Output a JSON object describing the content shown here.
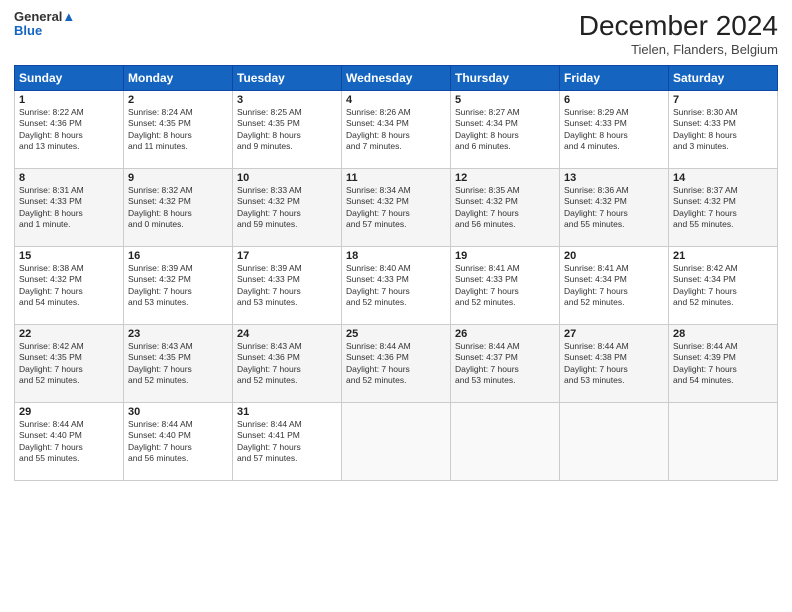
{
  "header": {
    "logo_line1": "General",
    "logo_line2": "Blue",
    "month": "December 2024",
    "location": "Tielen, Flanders, Belgium"
  },
  "weekdays": [
    "Sunday",
    "Monday",
    "Tuesday",
    "Wednesday",
    "Thursday",
    "Friday",
    "Saturday"
  ],
  "weeks": [
    [
      {
        "day": "1",
        "info": "Sunrise: 8:22 AM\nSunset: 4:36 PM\nDaylight: 8 hours\nand 13 minutes."
      },
      {
        "day": "2",
        "info": "Sunrise: 8:24 AM\nSunset: 4:35 PM\nDaylight: 8 hours\nand 11 minutes."
      },
      {
        "day": "3",
        "info": "Sunrise: 8:25 AM\nSunset: 4:35 PM\nDaylight: 8 hours\nand 9 minutes."
      },
      {
        "day": "4",
        "info": "Sunrise: 8:26 AM\nSunset: 4:34 PM\nDaylight: 8 hours\nand 7 minutes."
      },
      {
        "day": "5",
        "info": "Sunrise: 8:27 AM\nSunset: 4:34 PM\nDaylight: 8 hours\nand 6 minutes."
      },
      {
        "day": "6",
        "info": "Sunrise: 8:29 AM\nSunset: 4:33 PM\nDaylight: 8 hours\nand 4 minutes."
      },
      {
        "day": "7",
        "info": "Sunrise: 8:30 AM\nSunset: 4:33 PM\nDaylight: 8 hours\nand 3 minutes."
      }
    ],
    [
      {
        "day": "8",
        "info": "Sunrise: 8:31 AM\nSunset: 4:33 PM\nDaylight: 8 hours\nand 1 minute."
      },
      {
        "day": "9",
        "info": "Sunrise: 8:32 AM\nSunset: 4:32 PM\nDaylight: 8 hours\nand 0 minutes."
      },
      {
        "day": "10",
        "info": "Sunrise: 8:33 AM\nSunset: 4:32 PM\nDaylight: 7 hours\nand 59 minutes."
      },
      {
        "day": "11",
        "info": "Sunrise: 8:34 AM\nSunset: 4:32 PM\nDaylight: 7 hours\nand 57 minutes."
      },
      {
        "day": "12",
        "info": "Sunrise: 8:35 AM\nSunset: 4:32 PM\nDaylight: 7 hours\nand 56 minutes."
      },
      {
        "day": "13",
        "info": "Sunrise: 8:36 AM\nSunset: 4:32 PM\nDaylight: 7 hours\nand 55 minutes."
      },
      {
        "day": "14",
        "info": "Sunrise: 8:37 AM\nSunset: 4:32 PM\nDaylight: 7 hours\nand 55 minutes."
      }
    ],
    [
      {
        "day": "15",
        "info": "Sunrise: 8:38 AM\nSunset: 4:32 PM\nDaylight: 7 hours\nand 54 minutes."
      },
      {
        "day": "16",
        "info": "Sunrise: 8:39 AM\nSunset: 4:32 PM\nDaylight: 7 hours\nand 53 minutes."
      },
      {
        "day": "17",
        "info": "Sunrise: 8:39 AM\nSunset: 4:33 PM\nDaylight: 7 hours\nand 53 minutes."
      },
      {
        "day": "18",
        "info": "Sunrise: 8:40 AM\nSunset: 4:33 PM\nDaylight: 7 hours\nand 52 minutes."
      },
      {
        "day": "19",
        "info": "Sunrise: 8:41 AM\nSunset: 4:33 PM\nDaylight: 7 hours\nand 52 minutes."
      },
      {
        "day": "20",
        "info": "Sunrise: 8:41 AM\nSunset: 4:34 PM\nDaylight: 7 hours\nand 52 minutes."
      },
      {
        "day": "21",
        "info": "Sunrise: 8:42 AM\nSunset: 4:34 PM\nDaylight: 7 hours\nand 52 minutes."
      }
    ],
    [
      {
        "day": "22",
        "info": "Sunrise: 8:42 AM\nSunset: 4:35 PM\nDaylight: 7 hours\nand 52 minutes."
      },
      {
        "day": "23",
        "info": "Sunrise: 8:43 AM\nSunset: 4:35 PM\nDaylight: 7 hours\nand 52 minutes."
      },
      {
        "day": "24",
        "info": "Sunrise: 8:43 AM\nSunset: 4:36 PM\nDaylight: 7 hours\nand 52 minutes."
      },
      {
        "day": "25",
        "info": "Sunrise: 8:44 AM\nSunset: 4:36 PM\nDaylight: 7 hours\nand 52 minutes."
      },
      {
        "day": "26",
        "info": "Sunrise: 8:44 AM\nSunset: 4:37 PM\nDaylight: 7 hours\nand 53 minutes."
      },
      {
        "day": "27",
        "info": "Sunrise: 8:44 AM\nSunset: 4:38 PM\nDaylight: 7 hours\nand 53 minutes."
      },
      {
        "day": "28",
        "info": "Sunrise: 8:44 AM\nSunset: 4:39 PM\nDaylight: 7 hours\nand 54 minutes."
      }
    ],
    [
      {
        "day": "29",
        "info": "Sunrise: 8:44 AM\nSunset: 4:40 PM\nDaylight: 7 hours\nand 55 minutes."
      },
      {
        "day": "30",
        "info": "Sunrise: 8:44 AM\nSunset: 4:40 PM\nDaylight: 7 hours\nand 56 minutes."
      },
      {
        "day": "31",
        "info": "Sunrise: 8:44 AM\nSunset: 4:41 PM\nDaylight: 7 hours\nand 57 minutes."
      },
      {
        "day": "",
        "info": ""
      },
      {
        "day": "",
        "info": ""
      },
      {
        "day": "",
        "info": ""
      },
      {
        "day": "",
        "info": ""
      }
    ]
  ]
}
